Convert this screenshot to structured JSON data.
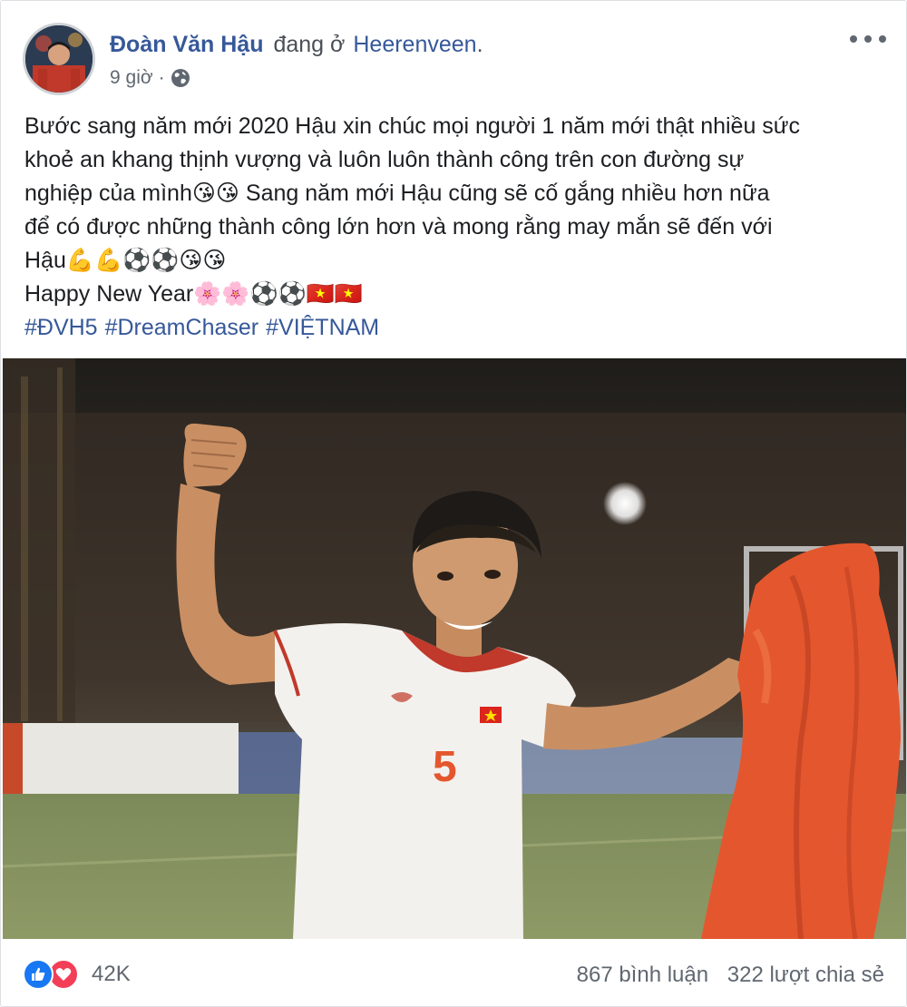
{
  "post": {
    "author": "Đoàn Văn Hậu",
    "at_text": "đang ở",
    "place": "Heerenveen",
    "place_end": ".",
    "time": "9 giờ",
    "time_sep": "·",
    "privacy_icon": "globe-icon",
    "menu_icon": "more-options-icon",
    "text_lines": [
      "Bước sang năm mới 2020 Hậu xin chúc mọi người 1 năm mới thật nhiều sức",
      "khoẻ an khang thịnh vượng và luôn luôn thành công trên con đường sự",
      "nghiệp của mình😘😘 Sang năm mới Hậu cũng sẽ cố gắng nhiều hơn nữa",
      "để có được những thành công lớn hơn và mong rằng may mắn sẽ đến với",
      "Hậu💪💪⚽⚽😘😘",
      "Happy New Year🌸🌸⚽⚽🇻🇳🇻🇳"
    ],
    "hashtags": [
      "#ĐVH5",
      "#DreamChaser",
      "#VIỆTNAM"
    ],
    "photo": {
      "jersey_number": "5"
    }
  },
  "footer": {
    "reaction_icons": [
      "like-icon",
      "love-icon"
    ],
    "reaction_count": "42K",
    "comments": "867 bình luận",
    "shares": "322 lượt chia sẻ"
  },
  "colors": {
    "link": "#365899",
    "text": "#1c1e21",
    "secondary": "#606770",
    "like": "#1877f2",
    "love": "#f33e58",
    "jersey_orange": "#e4572e"
  }
}
